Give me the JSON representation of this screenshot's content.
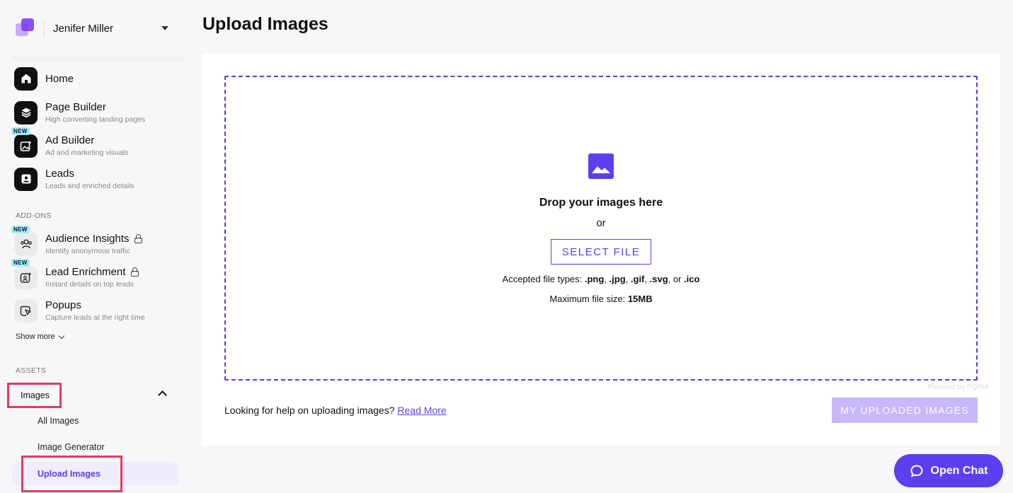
{
  "account": {
    "name": "Jenifer Miller"
  },
  "nav": {
    "main": [
      {
        "label": "Home",
        "sub": "",
        "icon": "home-icon",
        "badge": ""
      },
      {
        "label": "Page Builder",
        "sub": "High converting landing pages",
        "icon": "layers-icon",
        "badge": ""
      },
      {
        "label": "Ad Builder",
        "sub": "Ad and marketing visuals",
        "icon": "image-sparkle-icon",
        "badge": "NEW"
      },
      {
        "label": "Leads",
        "sub": "Leads and enriched details",
        "icon": "contact-icon",
        "badge": ""
      }
    ],
    "addons_title": "ADD-ONS",
    "addons": [
      {
        "label": "Audience Insights",
        "sub": "Identify anonymous traffic",
        "icon": "users-icon",
        "badge": "NEW",
        "locked": true
      },
      {
        "label": "Lead Enrichment",
        "sub": "Instant details on top leads",
        "icon": "enrich-icon",
        "badge": "NEW",
        "locked": true
      },
      {
        "label": "Popups",
        "sub": "Capture leads at the right time",
        "icon": "popup-icon",
        "badge": "",
        "locked": false
      }
    ],
    "show_more": "Show more",
    "assets_title": "ASSETS",
    "images": {
      "label": "Images",
      "items": [
        "All Images",
        "Image Generator",
        "Upload Images"
      ]
    }
  },
  "page": {
    "title": "Upload Images"
  },
  "upload": {
    "drop_title": "Drop your images here",
    "or": "or",
    "select_label": "SELECT FILE",
    "accepted_prefix": "Accepted file types: ",
    "types": [
      ".png",
      ".jpg",
      ".gif",
      ".svg",
      ".ico"
    ],
    "accepted_or": "or",
    "max_prefix": "Maximum file size: ",
    "max_value": "15MB",
    "powered": "Powered by PQINA"
  },
  "help": {
    "text": "Looking for help on uploading images? ",
    "link": "Read More"
  },
  "uploaded_button": "MY UPLOADED IMAGES",
  "chat": {
    "label": "Open Chat"
  },
  "colors": {
    "accent": "#5b3ff0",
    "highlight": "#e8385e",
    "badge": "#9ff0ea"
  }
}
